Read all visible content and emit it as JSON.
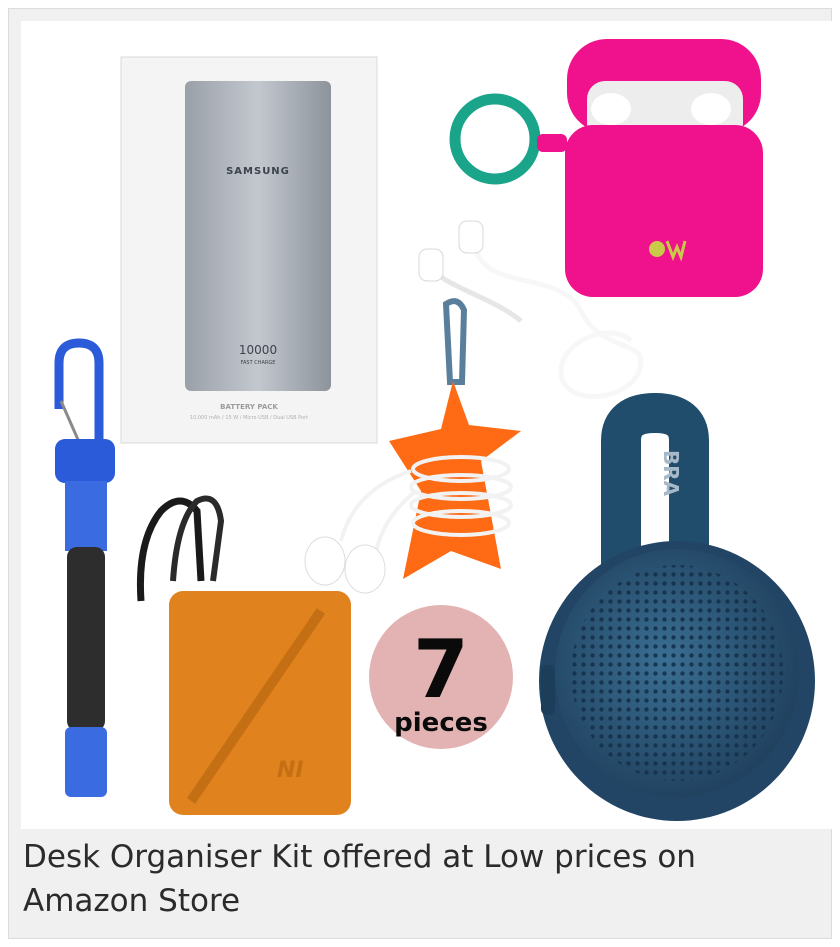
{
  "figure": {
    "caption": "Desk Organiser Kit offered at Low prices on Amazon Store",
    "badge": {
      "number": "7",
      "label": "pieces",
      "color": "#e3b3b3"
    },
    "product_print": {
      "powerbank_brand": "SAMSUNG",
      "powerbank_capacity": "10000",
      "powerbank_fast_charge": "FAST CHARGE",
      "box_title": "BATTERY PACK",
      "box_specs": "10,000 mAh / 15 W / Micro USB / Dual USB Port",
      "speaker_brand": "BRA",
      "pouch_logo": "NI"
    }
  }
}
